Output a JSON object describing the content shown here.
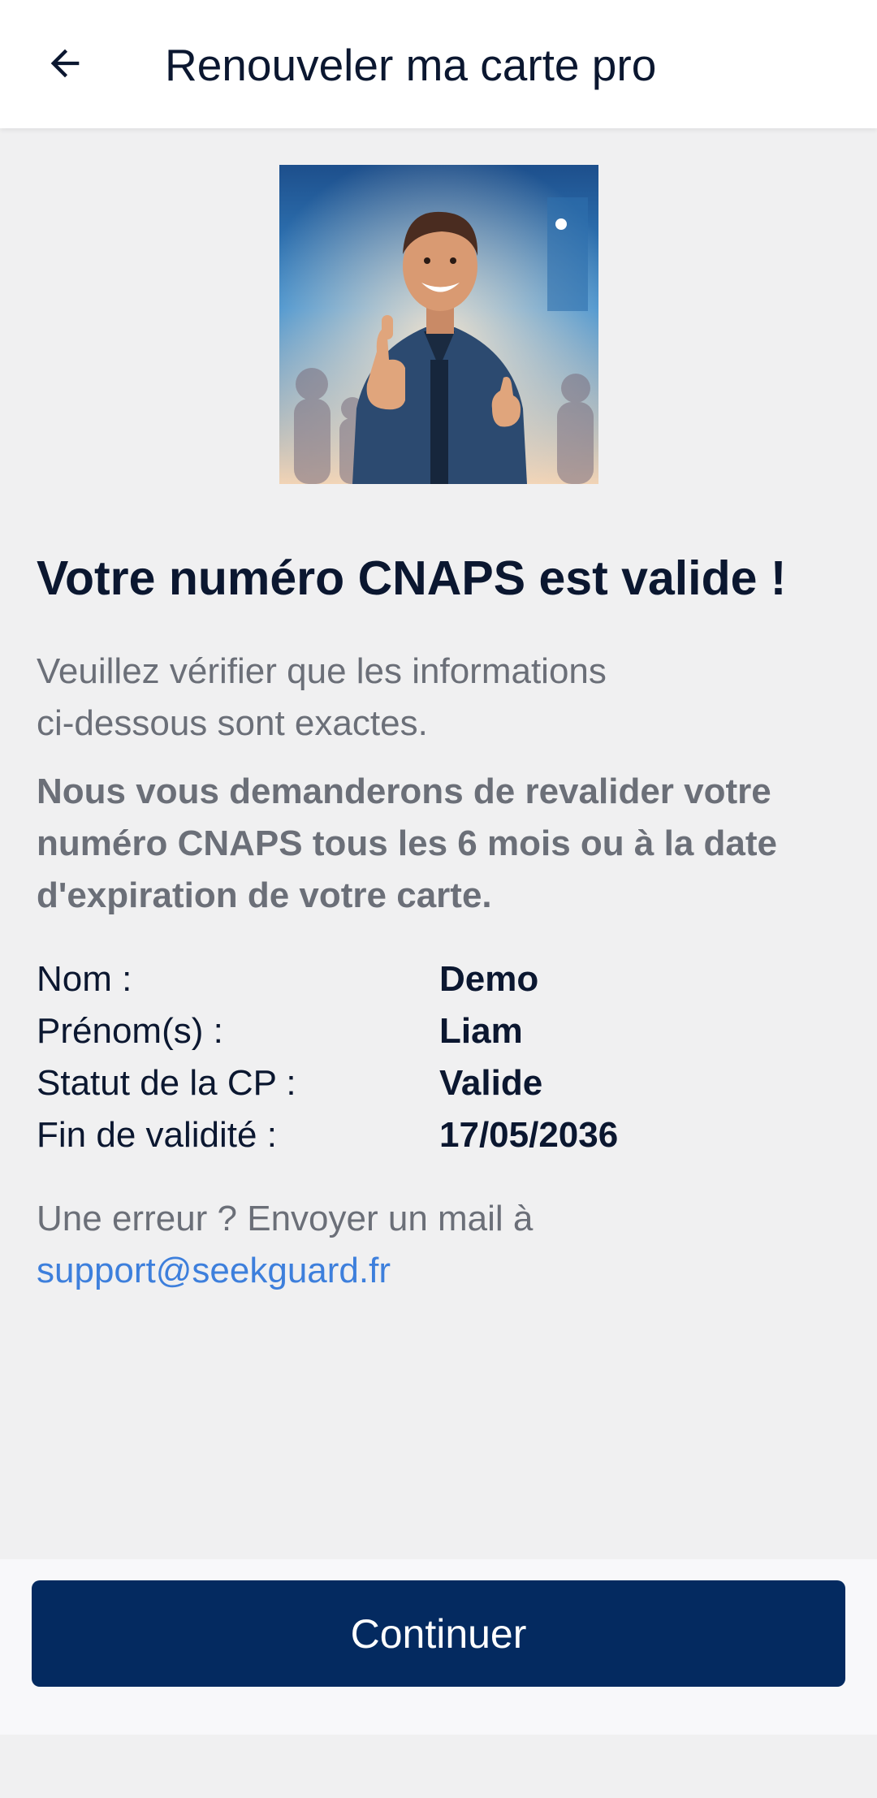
{
  "header": {
    "back_icon": "arrow-left-icon",
    "title": "Renouveler ma carte pro"
  },
  "hero": {
    "image_subject": "smiling security agent giving thumbs up"
  },
  "content": {
    "headline": "Votre numéro CNAPS est valide !",
    "intro_line1": "Veuillez vérifier que les informations",
    "intro_line2": "ci-dessous sont exactes.",
    "notice": "Nous vous demanderons de revalider votre numéro CNAPS tous les 6 mois ou à la date d'expiration de votre carte.",
    "info": [
      {
        "label": "Nom :",
        "value": "Demo"
      },
      {
        "label": "Prénom(s) :",
        "value": "Liam"
      },
      {
        "label": "Statut de la CP :",
        "value": "Valide"
      },
      {
        "label": "Fin de validité :",
        "value": "17/05/2036"
      }
    ],
    "support_text": "Une erreur ? Envoyer un mail à",
    "support_email": "support@seekguard.fr"
  },
  "footer": {
    "continue_label": "Continuer"
  },
  "colors": {
    "primary": "#042a60",
    "link": "#3d7fdc",
    "muted_text": "#6b6f78",
    "background": "#f0f0f1"
  }
}
